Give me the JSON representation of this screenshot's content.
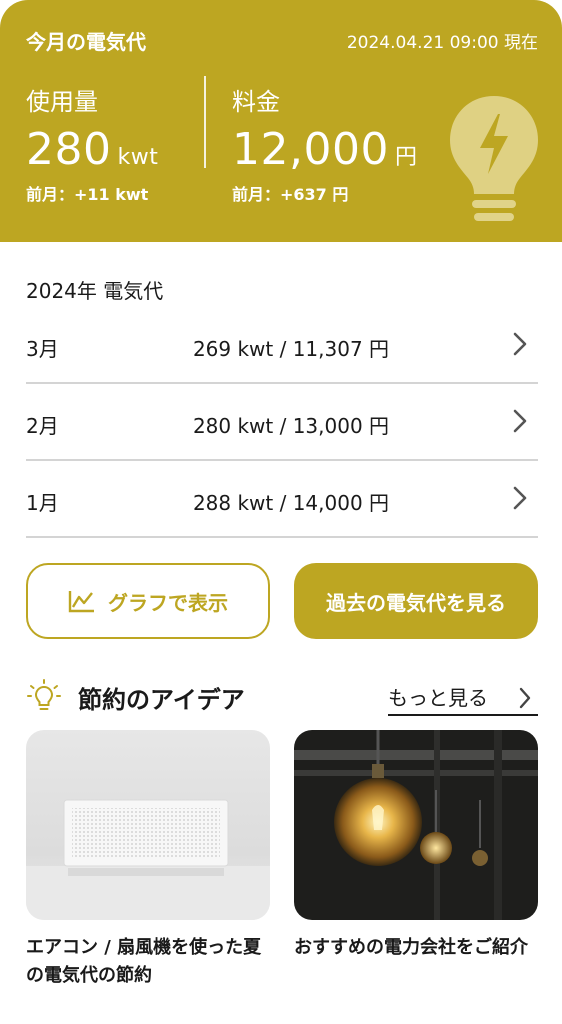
{
  "header": {
    "title": "今月の電気代",
    "timestamp": "2024.04.21 09:00 現在",
    "usage": {
      "label": "使用量",
      "value": "280",
      "unit": "kwt",
      "prev": "前月：+11 kwt"
    },
    "fee": {
      "label": "料金",
      "value": "12,000",
      "unit": "円",
      "prev": "前月：+637 円"
    },
    "icon": "lightbulb-bolt-icon"
  },
  "history": {
    "title": "2024年 電気代",
    "rows": [
      {
        "month": "3月",
        "detail": "269 kwt / 11,307 円"
      },
      {
        "month": "2月",
        "detail": "280 kwt / 13,000 円"
      },
      {
        "month": "1月",
        "detail": "288 kwt / 14,000 円"
      }
    ]
  },
  "buttons": {
    "graph": "グラフで表示",
    "past": "過去の電気代を見る"
  },
  "ideas": {
    "title": "節約のアイデア",
    "more": "もっと見る",
    "cards": [
      {
        "caption": "エアコン / 扇風機を使った夏の電気代の節約"
      },
      {
        "caption": "おすすめの電力会社をご紹介"
      }
    ]
  },
  "colors": {
    "accent": "#bda622",
    "divider": "#d4d4d4"
  }
}
